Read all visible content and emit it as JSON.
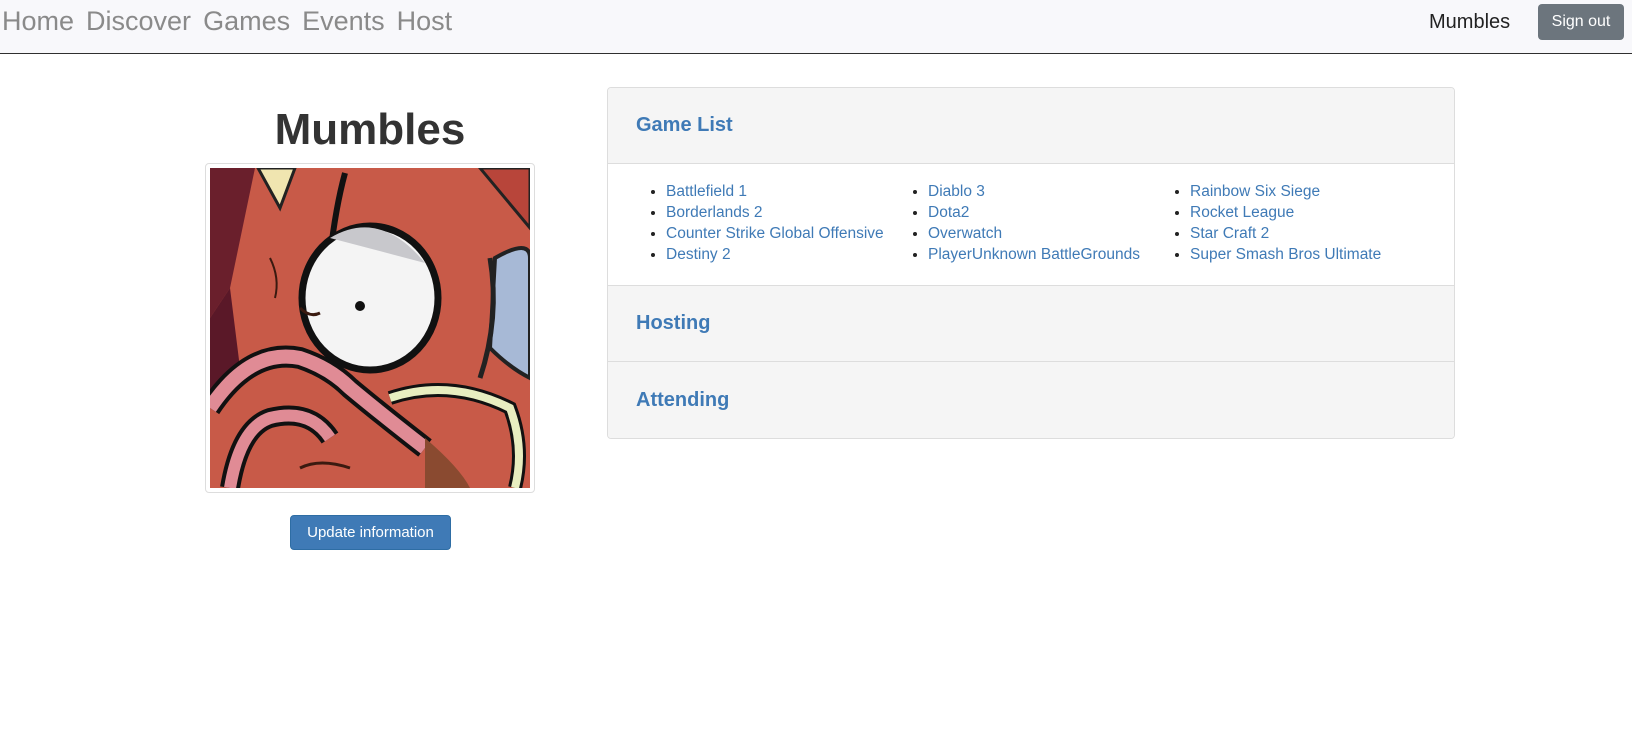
{
  "nav": {
    "links": [
      "Home",
      "Discover",
      "Games",
      "Events",
      "Host"
    ],
    "username": "Mumbles",
    "signout_label": "Sign out"
  },
  "profile": {
    "name": "Mumbles",
    "update_label": "Update information"
  },
  "sections": {
    "game_list_title": "Game List",
    "hosting_title": "Hosting",
    "attending_title": "Attending"
  },
  "games": {
    "col1": [
      "Battlefield 1",
      "Borderlands 2",
      "Counter Strike Global Offensive",
      "Destiny 2"
    ],
    "col2": [
      "Diablo 3",
      "Dota2",
      "Overwatch",
      "PlayerUnknown BattleGrounds"
    ],
    "col3": [
      "Rainbow Six Siege",
      "Rocket League",
      "Star Craft 2",
      "Super Smash Bros Ultimate"
    ]
  },
  "colors": {
    "link": "#3f7ab6",
    "primary_button": "#3f7ab6",
    "secondary_button": "#6c757d",
    "navbar_bg": "#f8f8fb",
    "panel_heading_bg": "#f5f5f5"
  }
}
